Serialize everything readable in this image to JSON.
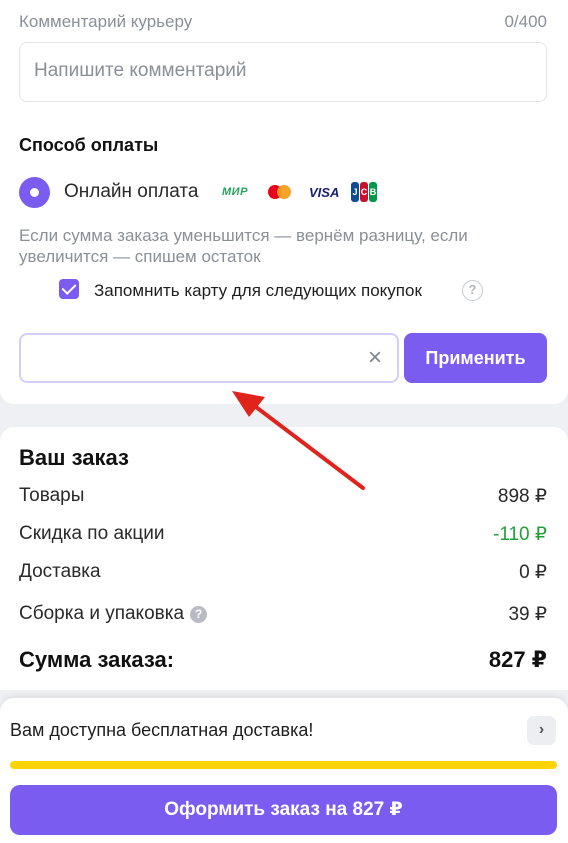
{
  "comment": {
    "label": "Комментарий курьеру",
    "counter": "0/400",
    "placeholder": "Напишите комментарий"
  },
  "payment": {
    "title": "Способ оплаты",
    "method": "Онлайн оплата",
    "logos": {
      "mir": "МИР",
      "visa": "VISA",
      "jcb": [
        "J",
        "C",
        "B"
      ]
    },
    "note": "Если сумма заказа уменьшится — вернём разницу, если увеличится — спишем остаток",
    "remember_label": "Запомнить карту для следующих покупок",
    "help_icon": "?",
    "remember_checked": true
  },
  "promo": {
    "input_value": "",
    "clear_icon": "×",
    "apply_label": "Применить"
  },
  "order": {
    "title": "Ваш заказ",
    "rows": [
      {
        "label": "Товары",
        "value": "898 ₽"
      },
      {
        "label": "Скидка по акции",
        "value": "-110 ₽"
      },
      {
        "label": "Доставка",
        "value": "0 ₽"
      },
      {
        "label": "Сборка и упаковка",
        "value": "39 ₽"
      }
    ],
    "info_icon": "?",
    "total_label": "Сумма заказа:",
    "total_value": "827 ₽"
  },
  "bottom": {
    "free_shipping_text": "Вам доступна бесплатная доставка!",
    "chevron_icon": "›",
    "progress_fraction": 1.0,
    "checkout_label": "Оформить заказ на 827 ₽"
  },
  "colors": {
    "accent": "#7b5cf0",
    "discount": "#21a038",
    "progress": "#ffd400",
    "annotation_arrow": "#e0231b"
  }
}
